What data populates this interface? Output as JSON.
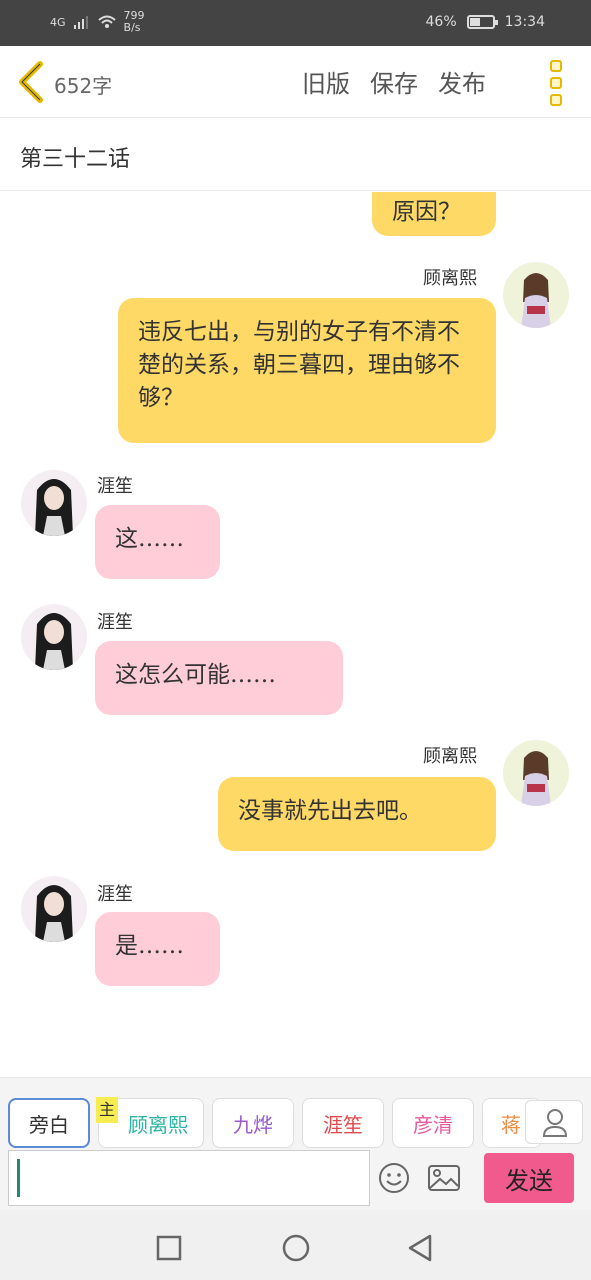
{
  "status": {
    "network": "4G",
    "speed_value": "799",
    "speed_unit": "B/s",
    "battery": "46%",
    "time": "13:34"
  },
  "header": {
    "word_count": "652字",
    "old_version": "旧版",
    "save": "保存",
    "publish": "发布"
  },
  "chapter_title": "第三十二话",
  "messages": [
    {
      "speaker": "",
      "side": "right",
      "text": "原因？"
    },
    {
      "speaker": "顾离熙",
      "side": "right",
      "text": "违反七出，与别的女子有不清不楚的关系，朝三暮四，理由够不够？"
    },
    {
      "speaker": "涯笙",
      "side": "left",
      "text": "这……"
    },
    {
      "speaker": "涯笙",
      "side": "left",
      "text": "这怎么可能……"
    },
    {
      "speaker": "顾离熙",
      "side": "right",
      "text": "没事就先出去吧。"
    },
    {
      "speaker": "涯笙",
      "side": "left",
      "text": "是……"
    }
  ],
  "characters": [
    {
      "label": "旁白",
      "color": "#333333"
    },
    {
      "label": "顾离熙",
      "color": "#2bb3a3"
    },
    {
      "label": "九烨",
      "color": "#9b59d0"
    },
    {
      "label": "涯笙",
      "color": "#e0484c"
    },
    {
      "label": "彦清",
      "color": "#e85aa0"
    },
    {
      "label": "蒋",
      "color": "#f08a3c"
    }
  ],
  "main_badge": "主",
  "send_label": "发送",
  "colors": {
    "my_bubble": "#ffd966",
    "other_bubble": "#ffcdd8",
    "send_button": "#f05a8d"
  }
}
